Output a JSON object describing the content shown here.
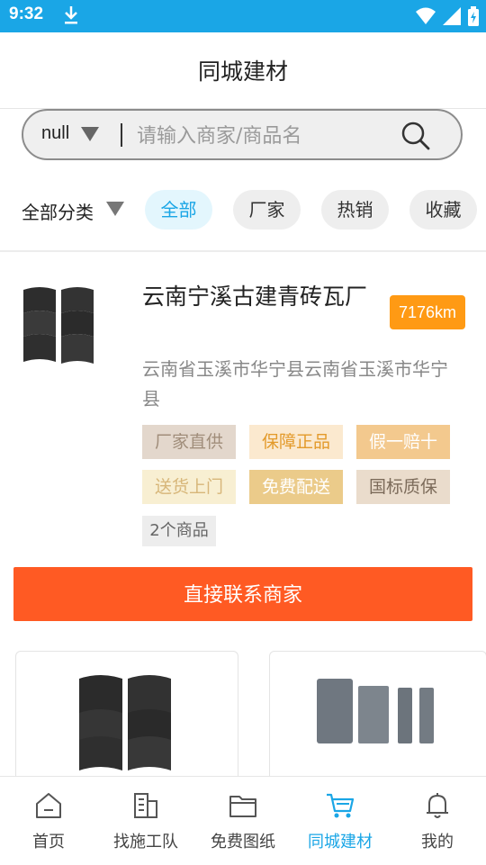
{
  "status_bar": {
    "time": "9:32"
  },
  "header": {
    "title": "同城建材"
  },
  "search": {
    "city": "null",
    "placeholder": "请输入商家/商品名"
  },
  "filters": {
    "category_label": "全部分类",
    "chips": [
      "全部",
      "厂家",
      "热销",
      "收藏"
    ],
    "active_index": 0
  },
  "shop": {
    "name": "云南宁溪古建青砖瓦厂",
    "distance": "7176km",
    "address": "云南省玉溪市华宁县云南省玉溪市华宁县",
    "tags": [
      {
        "label": "厂家直供",
        "bg": "#e3d7cc",
        "fg": "#a08d7a"
      },
      {
        "label": "保障正品",
        "bg": "#fbe9cf",
        "fg": "#e39a2a"
      },
      {
        "label": "假一赔十",
        "bg": "#f3c98e",
        "fg": "#ffffff"
      },
      {
        "label": "送货上门",
        "bg": "#f8efd2",
        "fg": "#d7b679"
      },
      {
        "label": "免费配送",
        "bg": "#ebcb8a",
        "fg": "#ffffff"
      },
      {
        "label": "国标质保",
        "bg": "#eadccc",
        "fg": "#7c6b5a"
      }
    ],
    "product_count": "2个商品",
    "contact_label": "直接联系商家"
  },
  "nav": {
    "items": [
      "首页",
      "找施工队",
      "免费图纸",
      "同城建材",
      "我的"
    ],
    "active_index": 3,
    "active_color": "#1aa6e6"
  }
}
